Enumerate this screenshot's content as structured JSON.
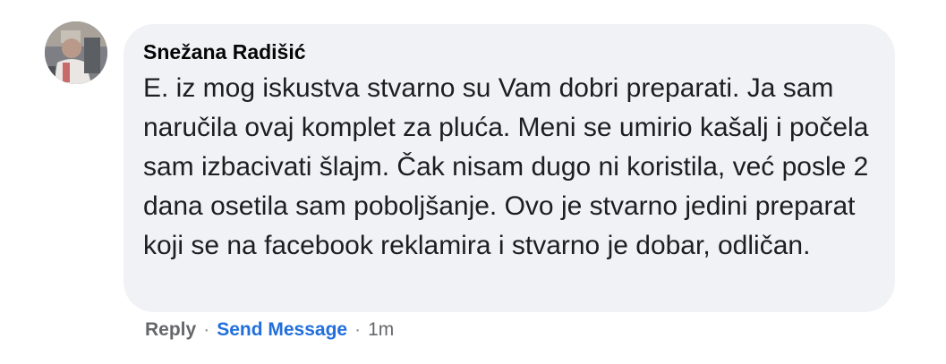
{
  "comment": {
    "author": "Snežana Radišić",
    "text": "E. iz mog iskustva stvarno su Vam dobri preparati. Ja sam naručila ovaj komplet za pluća. Meni se umirio kašalj i počela sam izbacivati šlajm. Čak nisam dugo ni koristila, već posle 2 dana osetila sam poboljšanje. Ovo je stvarno jedini preparat koji se na facebook reklamira i stvarno je dobar, odličan.",
    "actions": {
      "reply_label": "Reply",
      "separator": "·",
      "send_message_label": "Send Message",
      "timestamp": "1m"
    }
  },
  "colors": {
    "bubble_bg": "#f0f2f5",
    "author": "#050505",
    "text": "#1c1e21",
    "muted": "#65676b",
    "link": "#216fdb"
  }
}
